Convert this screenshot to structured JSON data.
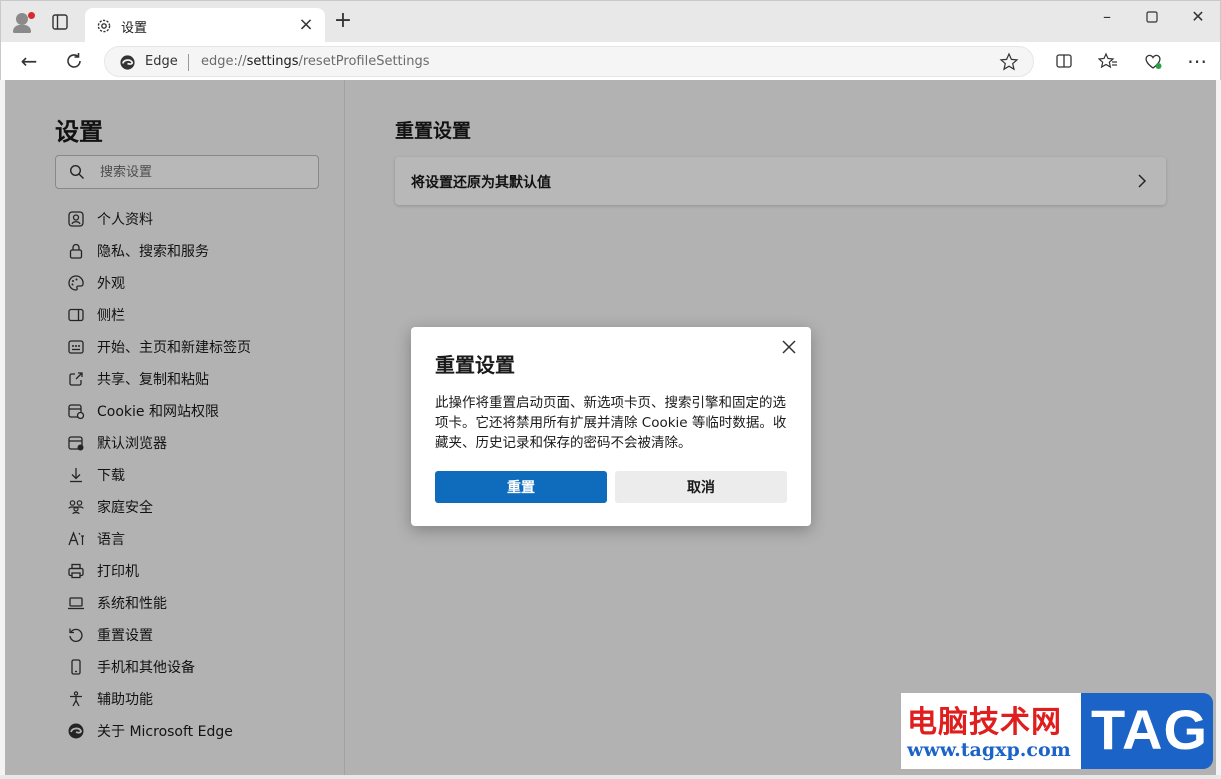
{
  "browser": {
    "tab_title": "设置",
    "address": {
      "site_label": "Edge",
      "url_scheme": "edge://",
      "url_host": "settings",
      "url_path": "/resetProfileSettings"
    }
  },
  "sidebar": {
    "title": "设置",
    "search_placeholder": "搜索设置",
    "items": [
      {
        "label": "个人资料",
        "icon": "profile-icon"
      },
      {
        "label": "隐私、搜索和服务",
        "icon": "lock-icon"
      },
      {
        "label": "外观",
        "icon": "palette-icon"
      },
      {
        "label": "侧栏",
        "icon": "sidebar-icon"
      },
      {
        "label": "开始、主页和新建标签页",
        "icon": "start-page-icon"
      },
      {
        "label": "共享、复制和粘贴",
        "icon": "share-icon"
      },
      {
        "label": "Cookie 和网站权限",
        "icon": "cookie-icon"
      },
      {
        "label": "默认浏览器",
        "icon": "default-browser-icon"
      },
      {
        "label": "下载",
        "icon": "download-icon"
      },
      {
        "label": "家庭安全",
        "icon": "family-icon"
      },
      {
        "label": "语言",
        "icon": "language-icon"
      },
      {
        "label": "打印机",
        "icon": "printer-icon"
      },
      {
        "label": "系统和性能",
        "icon": "laptop-icon"
      },
      {
        "label": "重置设置",
        "icon": "reset-icon"
      },
      {
        "label": "手机和其他设备",
        "icon": "phone-icon"
      },
      {
        "label": "辅助功能",
        "icon": "accessibility-icon"
      },
      {
        "label": "关于 Microsoft Edge",
        "icon": "edge-logo-icon"
      }
    ]
  },
  "main": {
    "title": "重置设置",
    "card_label": "将设置还原为其默认值"
  },
  "dialog": {
    "title": "重置设置",
    "body": "此操作将重置启动页面、新选项卡页、搜索引擎和固定的选项卡。它还将禁用所有扩展并清除 Cookie 等临时数据。收藏夹、历史记录和保存的密码不会被清除。",
    "primary_label": "重置",
    "secondary_label": "取消"
  },
  "watermark": {
    "text_cn": "电脑技术网",
    "url": "www.tagxp.com",
    "tag": "TAG"
  },
  "colors": {
    "accent": "#0f6cbd",
    "watermark_red": "#e01e1e",
    "watermark_blue": "#1b63c6"
  }
}
